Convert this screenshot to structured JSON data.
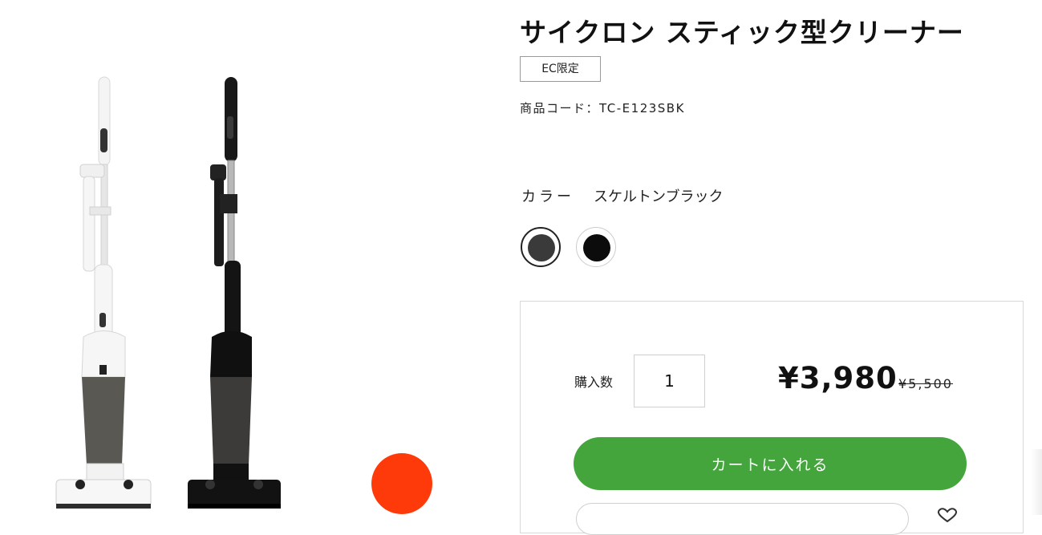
{
  "product": {
    "title": "サイクロン スティック型クリーナー",
    "badge": "EC限定",
    "code_label": "商品コード：TC-E123SBK"
  },
  "colors": {
    "label": "カラー",
    "selected_name": "スケルトンブラック",
    "swatches": [
      {
        "name": "スケルトンブラック",
        "hex": "#3a3a3a",
        "selected": true
      },
      {
        "name": "ブラック",
        "hex": "#0c0c0c",
        "selected": false
      }
    ]
  },
  "purchase": {
    "quantity_label": "購入数",
    "quantity_value": "1",
    "price": "¥3,980",
    "original_price": "¥5,500",
    "cart_button": "カートに入れる"
  },
  "theme": {
    "accent_green": "#43a53c",
    "dot_orange": "#ff3a0a"
  },
  "icons": [
    "heart-icon"
  ]
}
